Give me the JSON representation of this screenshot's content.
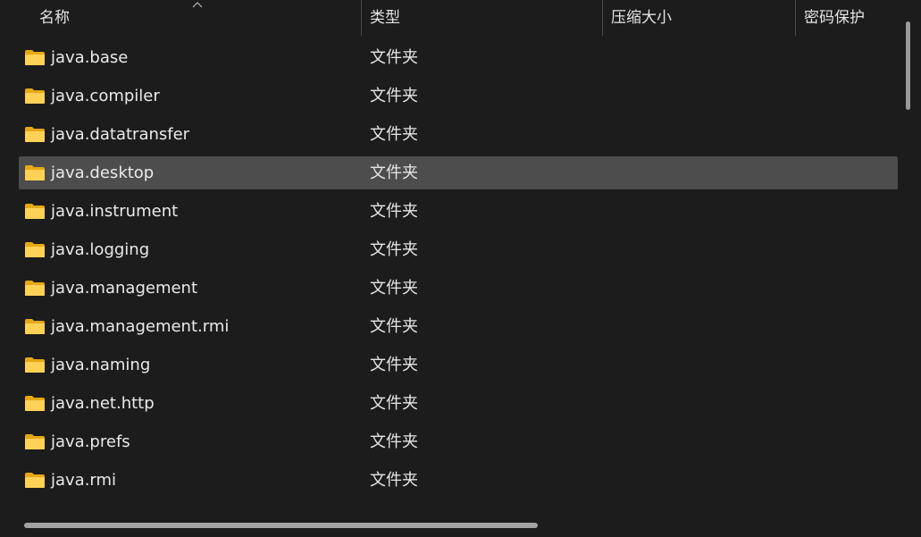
{
  "columns": {
    "name": "名称",
    "type": "类型",
    "compressed_size": "压缩大小",
    "password": "密码保护"
  },
  "rows": [
    {
      "name": "java.base",
      "type": "文件夹",
      "selected": false
    },
    {
      "name": "java.compiler",
      "type": "文件夹",
      "selected": false
    },
    {
      "name": "java.datatransfer",
      "type": "文件夹",
      "selected": false
    },
    {
      "name": "java.desktop",
      "type": "文件夹",
      "selected": true
    },
    {
      "name": "java.instrument",
      "type": "文件夹",
      "selected": false
    },
    {
      "name": "java.logging",
      "type": "文件夹",
      "selected": false
    },
    {
      "name": "java.management",
      "type": "文件夹",
      "selected": false
    },
    {
      "name": "java.management.rmi",
      "type": "文件夹",
      "selected": false
    },
    {
      "name": "java.naming",
      "type": "文件夹",
      "selected": false
    },
    {
      "name": "java.net.http",
      "type": "文件夹",
      "selected": false
    },
    {
      "name": "java.prefs",
      "type": "文件夹",
      "selected": false
    },
    {
      "name": "java.rmi",
      "type": "文件夹",
      "selected": false
    }
  ],
  "colors": {
    "background": "#1c1c1c",
    "selected_row": "#4d4d4d",
    "folder_back": "#e6a816",
    "folder_front": "#ffd155"
  }
}
